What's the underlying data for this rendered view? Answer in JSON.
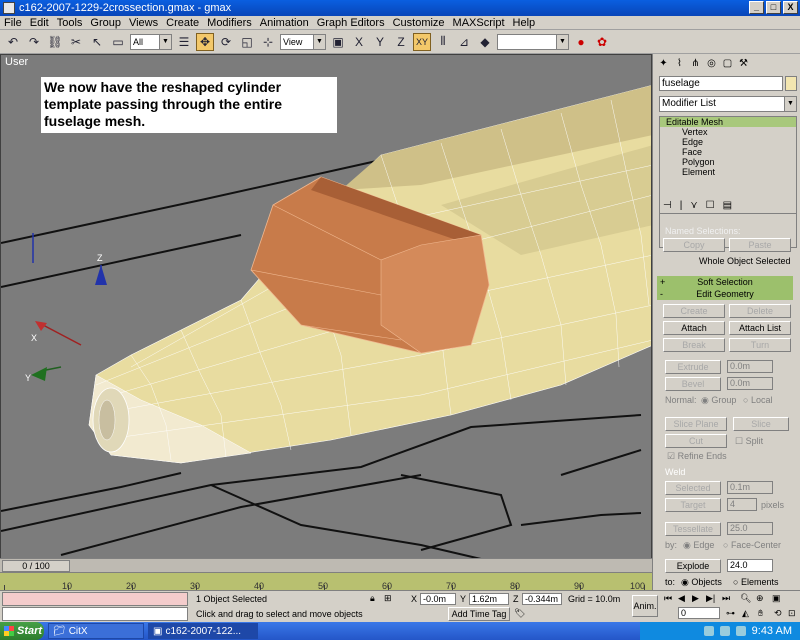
{
  "window": {
    "title": "c162-2007-1229-2crossection.gmax - gmax",
    "minimize": "_",
    "maximize": "□",
    "close": "X"
  },
  "menu": [
    "File",
    "Edit",
    "Tools",
    "Group",
    "Views",
    "Create",
    "Modifiers",
    "Animation",
    "Graph Editors",
    "Customize",
    "MAXScript",
    "Help"
  ],
  "toolbar": {
    "selection_filter": "All",
    "ref_coord": "View",
    "axis_x": "X",
    "axis_y": "Y",
    "axis_z": "Z",
    "axis_xy": "XY"
  },
  "viewport": {
    "label": "User",
    "note": "We now have the reshaped cylinder template passing through the entire fuselage mesh.",
    "axis_labels": [
      "Z",
      "X",
      "Y"
    ]
  },
  "command_panel": {
    "object_name": "fuselage",
    "modifier_list": "Modifier List",
    "stack": [
      "Editable Mesh",
      "Vertex",
      "Edge",
      "Face",
      "Polygon",
      "Element"
    ],
    "named_selections": "Named Selections:",
    "copy": "Copy",
    "paste": "Paste",
    "whole_object": "Whole Object Selected",
    "soft_selection": "Soft Selection",
    "edit_geometry": "Edit Geometry",
    "create": "Create",
    "delete": "Delete",
    "attach": "Attach",
    "attach_list": "Attach List",
    "break": "Break",
    "turn": "Turn",
    "extrude": "Extrude",
    "extrude_val": "0.0m",
    "bevel": "Bevel",
    "bevel_val": "0.0m",
    "normal": "Normal:",
    "group": "Group",
    "local": "Local",
    "slice_plane": "Slice Plane",
    "slice": "Slice",
    "cut": "Cut",
    "split": "Split",
    "refine_ends": "Refine Ends",
    "weld": "Weld",
    "selected": "Selected",
    "selected_val": "0.1m",
    "target": "Target",
    "target_val": "4",
    "pixels": "pixels",
    "tessellate": "Tessellate",
    "tess_val": "25.0",
    "by": "by:",
    "edge": "Edge",
    "face_center": "Face-Center",
    "explode": "Explode",
    "explode_val": "24.0",
    "to": "to:",
    "objects": "Objects",
    "elements": "Elements"
  },
  "timeline": {
    "slider": "0 / 100",
    "ticks": [
      "10",
      "20",
      "30",
      "40",
      "50",
      "60",
      "70",
      "80",
      "90",
      "100"
    ]
  },
  "status": {
    "selection": "1 Object Selected",
    "prompt": "Click and drag to select and move objects",
    "x_label": "X",
    "x_val": "-0.0m",
    "y_label": "Y",
    "y_val": "1.62m",
    "z_label": "Z",
    "z_val": "-0.344m",
    "grid": "Grid = 10.0m",
    "add_time_tag": "Add Time Tag",
    "anim": "Anim.",
    "frame": "0"
  },
  "taskbar": {
    "start": "Start",
    "items": [
      "CitX",
      "c162-2007-122..."
    ],
    "time": "9:43 AM"
  },
  "colors": {
    "viewport_bg": "#7c7c7c",
    "fuselage": "#e8dca0",
    "template": "#c87b4a",
    "rollout_header": "#9cc06c"
  }
}
